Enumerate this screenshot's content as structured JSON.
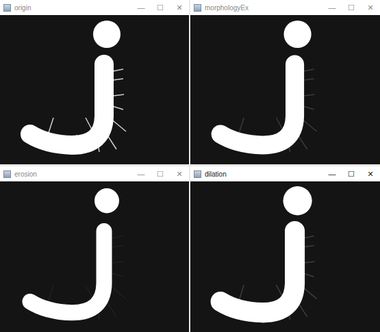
{
  "windows": [
    {
      "title": "origin",
      "active": false,
      "kind": "origin"
    },
    {
      "title": "morphologyEx",
      "active": false,
      "kind": "opened"
    },
    {
      "title": "erosion",
      "active": false,
      "kind": "eroded"
    },
    {
      "title": "dilation",
      "active": true,
      "kind": "dilated"
    }
  ],
  "controls": [
    "—",
    "☐",
    "✕"
  ]
}
